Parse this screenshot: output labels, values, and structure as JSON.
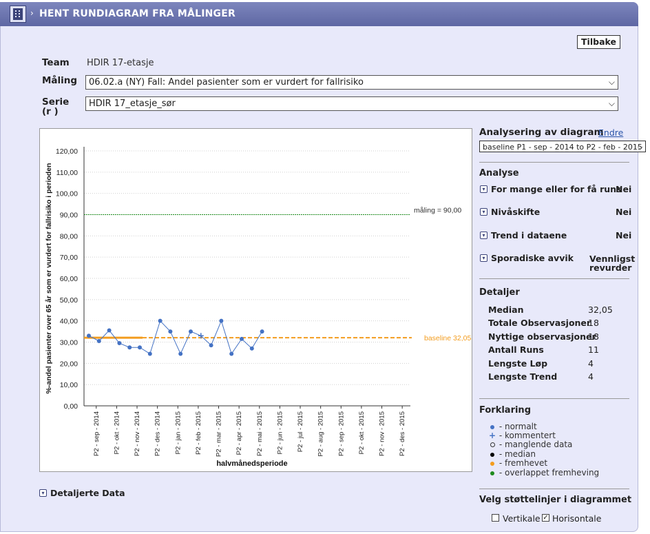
{
  "header": {
    "title": "HENT RUNDIAGRAM FRA MÅLINGER",
    "chevron": "›"
  },
  "back_button": "Tilbake",
  "form": {
    "team_label": "Team",
    "team_value": "HDIR 17-etasje",
    "measurement_label": "Måling",
    "measurement_value": "06.02.a (NY) Fall: Andel pasienter som er vurdert for fallrisiko",
    "series_label_1": "Serie",
    "series_label_2": "(r )",
    "series_value": "HDIR 17_etasje_sør"
  },
  "chart_data": {
    "type": "line",
    "xlabel": "halvmånedsperiode",
    "ylabel": "%-andel pasienter over 65 år som er vurdert for fallrisiko i perioden",
    "ylim": [
      0,
      120
    ],
    "yticks": [
      "0,00",
      "10,00",
      "20,00",
      "30,00",
      "40,00",
      "50,00",
      "60,00",
      "70,00",
      "80,00",
      "90,00",
      "100,00",
      "110,00",
      "120,00"
    ],
    "categories": [
      "P2 - sep - 2014",
      "P2 - okt - 2014",
      "P2 - nov - 2014",
      "P2 - des - 2014",
      "P2 - jan - 2015",
      "P2 - feb - 2015",
      "P2 - mar - 2015",
      "P2 - apr - 2015",
      "P2 - mai - 2015",
      "P2 - jun - 2015",
      "P2 - jul - 2015",
      "P2 - aug - 2015",
      "P2 - sep - 2015",
      "P2 - okt - 2015",
      "P2 - nov - 2015",
      "P2 - des - 2015"
    ],
    "series": [
      {
        "values": [
          33,
          30.5,
          35.5,
          29.5,
          27.5,
          27.5,
          24.5,
          40,
          35,
          24.5,
          35,
          33,
          28.5,
          40,
          24.5,
          31.5,
          27,
          35
        ]
      }
    ],
    "commented_point_index": 11,
    "target": {
      "value": 90,
      "label": "måling = 90,00",
      "color": "#1e8a1e"
    },
    "baseline": {
      "value": 32.05,
      "label": "baseline 32,05",
      "color": "#f39c1e"
    },
    "grid": true,
    "series_color": "#4472c4"
  },
  "analysis": {
    "title": "Analysering av diagram",
    "change_link": "Endre",
    "baseline_select": "baseline P1 - sep - 2014 to P2 - feb - 2015",
    "section_title": "Analyse",
    "rows": [
      {
        "label": "For mange eller for få runs",
        "value": "Nei"
      },
      {
        "label": "Nivåskifte",
        "value": "Nei"
      },
      {
        "label": "Trend i dataene",
        "value": "Nei"
      },
      {
        "label": "Sporadiske avvik",
        "value_1": "Vennligst",
        "value_2": "revurder"
      }
    ]
  },
  "details": {
    "title": "Detaljer",
    "rows": [
      {
        "label": "Median",
        "value": "32,05"
      },
      {
        "label": "Totale Observasjoner",
        "value": "18"
      },
      {
        "label": "Nyttige observasjoner",
        "value": "18"
      },
      {
        "label": "Antall Runs",
        "value": "11"
      },
      {
        "label": "Lengste Løp",
        "value": "4"
      },
      {
        "label": "Lengste Trend",
        "value": "4"
      }
    ]
  },
  "legend": {
    "title": "Forklaring",
    "items": [
      {
        "symbol": "dot",
        "color": "#4472c4",
        "label": "- normalt"
      },
      {
        "symbol": "plus",
        "color": "#4472c4",
        "label": "- kommentert"
      },
      {
        "symbol": "ring",
        "color": "#333333",
        "label": "- manglende data"
      },
      {
        "symbol": "dot",
        "color": "#000000",
        "label": "- median"
      },
      {
        "symbol": "dot",
        "color": "#f39c1e",
        "label": "- fremhevet"
      },
      {
        "symbol": "dot",
        "color": "#1e8a1e",
        "label": "- overlappet fremheving"
      }
    ]
  },
  "gridlines": {
    "title": "Velg støttelinjer i diagrammet",
    "vertical_label": "Vertikale",
    "vertical_checked": false,
    "horizontal_label": "Horisontale",
    "horizontal_checked": true
  },
  "detailed_data": "Detaljerte Data"
}
